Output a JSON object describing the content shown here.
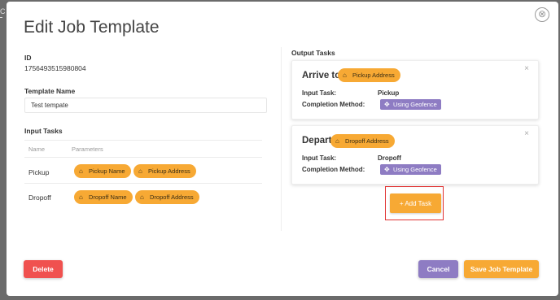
{
  "modal": {
    "title": "Edit Job Template",
    "close_icon": "⊗"
  },
  "form": {
    "id_label": "ID",
    "id_value": "1756493515980804",
    "template_name_label": "Template Name",
    "template_name_value": "Test tempate"
  },
  "input_tasks": {
    "label": "Input Tasks",
    "col_name": "Name",
    "col_params": "Parameters",
    "rows": [
      {
        "name": "Pickup",
        "params": [
          {
            "label": "Pickup Name",
            "icon": "store-icon",
            "glyph": "⌂"
          },
          {
            "label": "Pickup Address",
            "icon": "store-icon",
            "glyph": "⌂"
          }
        ]
      },
      {
        "name": "Dropoff",
        "params": [
          {
            "label": "Dropoff Name",
            "icon": "home-icon",
            "glyph": "⌂"
          },
          {
            "label": "Dropoff Address",
            "icon": "home-icon",
            "glyph": "⌂"
          }
        ]
      }
    ]
  },
  "output_tasks": {
    "label": "Output Tasks",
    "tasks": [
      {
        "title": "Arrive to",
        "pill_label": "Pickup Address",
        "pill_icon": "store-icon",
        "input_task_label": "Input Task:",
        "input_task_value": "Pickup",
        "completion_label": "Completion Method:",
        "completion_value": "Using Geofence",
        "close": "×"
      },
      {
        "title": "Depart",
        "pill_label": "Dropoff Address",
        "pill_icon": "home-icon",
        "input_task_label": "Input Task:",
        "input_task_value": "Dropoff",
        "completion_label": "Completion Method:",
        "completion_value": "Using Geofence",
        "close": "×"
      }
    ],
    "add_task_label": "+ Add Task"
  },
  "footer": {
    "delete_label": "Delete",
    "cancel_label": "Cancel",
    "save_label": "Save Job Template"
  },
  "background": {
    "edge_text": "C"
  },
  "colors": {
    "accent_orange": "#f7a934",
    "accent_purple": "#8e7cc3",
    "danger_red": "#f0514f",
    "highlight_red": "#e03030"
  },
  "icons": {
    "geofence_glyph": "✥",
    "store_glyph": "⌂"
  }
}
